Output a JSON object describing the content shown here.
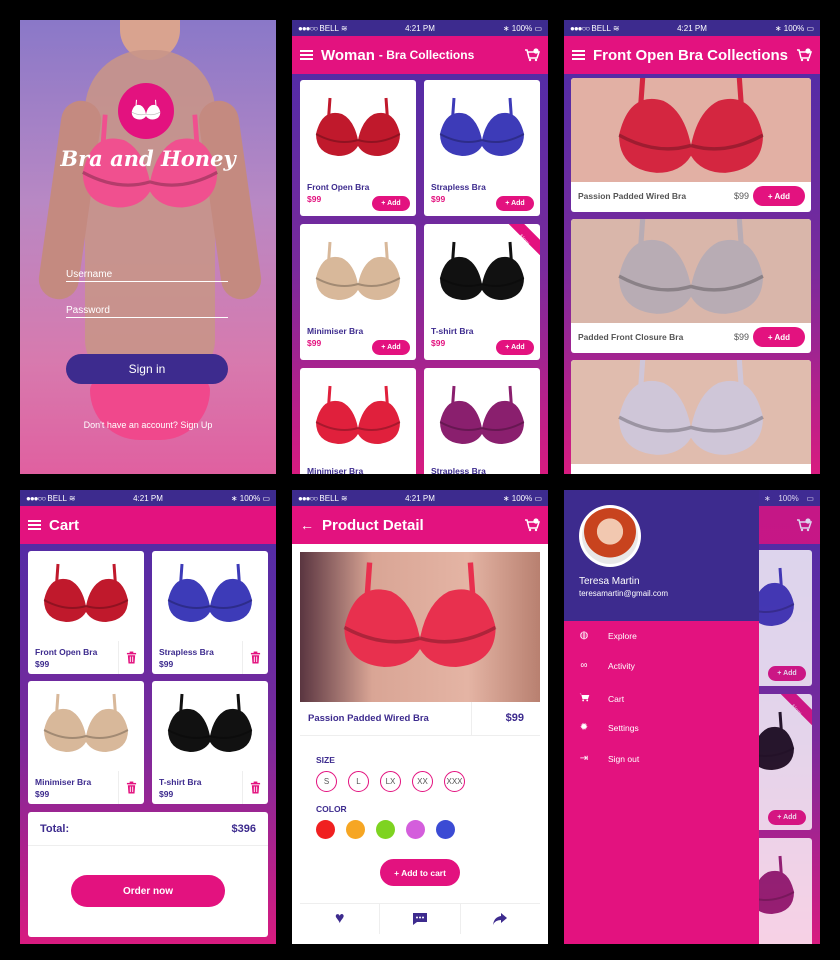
{
  "status": {
    "carrier": "BELL",
    "time": "4:21 PM",
    "battery": "100%"
  },
  "login": {
    "app_name": "Bra and Honey",
    "username_label": "Username",
    "password_label": "Password",
    "signin_label": "Sign in",
    "signup_text": "Don't have an account? Sign Up"
  },
  "collections": {
    "title": "Woman",
    "subtitle": "- Bra Collections",
    "add_label": "+ Add",
    "new_badge": "New",
    "products": [
      {
        "name": "Front Open Bra",
        "price": "$99"
      },
      {
        "name": "Strapless Bra",
        "price": "$99"
      },
      {
        "name": "Minimiser Bra",
        "price": "$99"
      },
      {
        "name": "T-shirt Bra",
        "price": "$99"
      },
      {
        "name": "Minimiser Bra",
        "price": ""
      },
      {
        "name": "Strapless Bra",
        "price": ""
      }
    ]
  },
  "front_open": {
    "title": "Front Open Bra Collections",
    "add_label": "+ Add",
    "products": [
      {
        "name": "Passion Padded Wired Bra",
        "price": "$99"
      },
      {
        "name": "Padded Front Closure Bra",
        "price": "$99"
      }
    ]
  },
  "cart": {
    "title": "Cart",
    "items": [
      {
        "name": "Front Open Bra",
        "price": "$99"
      },
      {
        "name": "Strapless Bra",
        "price": "$99"
      },
      {
        "name": "Minimiser Bra",
        "price": "$99"
      },
      {
        "name": "T-shirt Bra",
        "price": "$99"
      }
    ],
    "total_label": "Total:",
    "total_value": "$396",
    "order_label": "Order now"
  },
  "detail": {
    "title": "Product Detail",
    "product_name": "Passion Padded Wired Bra",
    "price": "$99",
    "size_label": "SIZE",
    "sizes": [
      "S",
      "L",
      "LX",
      "XX",
      "XXX"
    ],
    "color_label": "COLOR",
    "colors": [
      "#f02020",
      "#f6a623",
      "#7ed321",
      "#d45edc",
      "#3b4bd4"
    ],
    "add_to_cart": "+ Add to cart"
  },
  "drawer": {
    "user_name": "Teresa Martin",
    "email": "teresamartin@gmail.com",
    "items": [
      {
        "label": "Explore",
        "icon": "globe-icon"
      },
      {
        "label": "Activity",
        "icon": "binoculars-icon"
      },
      {
        "label": "Cart",
        "icon": "cart-icon"
      },
      {
        "label": "Settings",
        "icon": "gear-icon"
      },
      {
        "label": "Sign out",
        "icon": "sign-out-icon"
      }
    ]
  },
  "colors": {
    "accent": "#e3127f",
    "primary": "#3d2b8e",
    "gradient_top": "#4a2ca8"
  }
}
